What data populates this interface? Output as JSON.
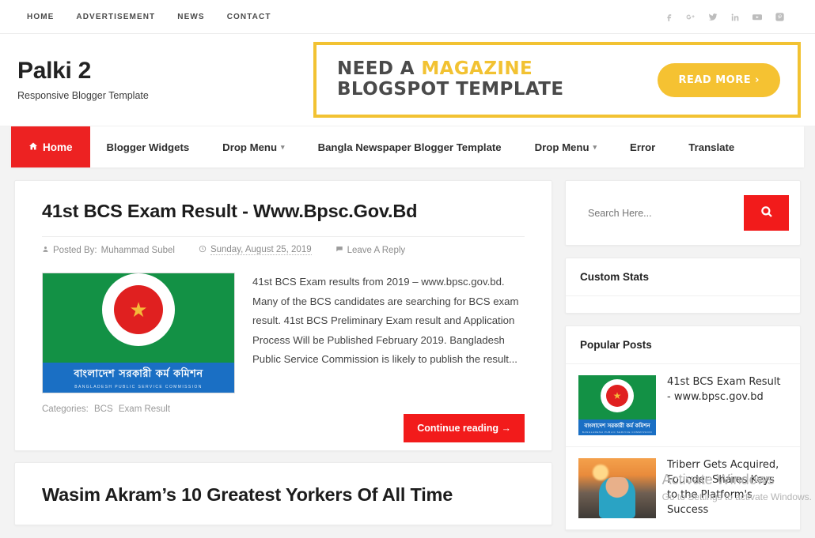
{
  "topbar": {
    "nav": [
      {
        "label": "HOME"
      },
      {
        "label": "ADVERTISEMENT"
      },
      {
        "label": "NEWS"
      },
      {
        "label": "CONTACT"
      }
    ],
    "social": [
      {
        "name": "facebook-icon",
        "glyph": "f"
      },
      {
        "name": "google-plus-icon",
        "glyph": "G+"
      },
      {
        "name": "twitter-icon",
        "glyph": "t"
      },
      {
        "name": "linkedin-icon",
        "glyph": "in"
      },
      {
        "name": "youtube-icon",
        "glyph": "yt"
      },
      {
        "name": "pinterest-icon",
        "glyph": "P"
      }
    ]
  },
  "header": {
    "site_title": "Palki 2",
    "tagline": "Responsive Blogger Template",
    "banner": {
      "line1_plain": "NEED A ",
      "line1_highlight": "MAGAZINE",
      "line2": "BLOGSPOT TEMPLATE",
      "button_label": "READ MORE ›",
      "border_color": "#f2c232",
      "accent_color": "#f2c232"
    }
  },
  "mainnav": {
    "home_label": "Home",
    "home_icon": "home-icon",
    "active_color": "#ed2222",
    "items": [
      {
        "label": "Blogger Widgets",
        "has_caret": false
      },
      {
        "label": "Drop Menu",
        "has_caret": true
      },
      {
        "label": "Bangla Newspaper Blogger Template",
        "has_caret": false
      },
      {
        "label": "Drop Menu",
        "has_caret": true
      },
      {
        "label": "Error",
        "has_caret": false
      },
      {
        "label": "Translate",
        "has_caret": false
      }
    ]
  },
  "posts": [
    {
      "title": "41st BCS Exam Result - Www.Bpsc.Gov.Bd",
      "meta": {
        "author_label": "Posted By:",
        "author": "Muhammad Subel",
        "date": "Sunday, August 25, 2019",
        "comments": "Leave A Reply"
      },
      "thumb": {
        "name": "bpsc-logo-thumbnail",
        "band_bn": "বাংলাদেশ সরকারী কর্ম কমিশন",
        "band_en": "BANGLADESH PUBLIC SERVICE COMMISSION"
      },
      "excerpt": "41st BCS Exam results from 2019 – www.bpsc.gov.bd. Many of the BCS candidates are searching for BCS exam result. 41st BCS Preliminary Exam result and Application Process Will be Published February 2019. Bangladesh Public Service Commission is likely to publish the result...",
      "categories_label": "Categories:",
      "categories": [
        "BCS",
        "Exam Result"
      ],
      "continue_label": "Continue reading →"
    },
    {
      "title": "Wasim Akram’s 10 Greatest Yorkers Of All Time"
    }
  ],
  "sidebar": {
    "search": {
      "placeholder": "Search Here...",
      "button_icon": "search-icon",
      "button_color": "#f21b1b"
    },
    "widgets": [
      {
        "title": "Custom Stats"
      },
      {
        "title": "Popular Posts"
      }
    ],
    "popular_posts": [
      {
        "title": "41st BCS Exam Result - www.bpsc.gov.bd",
        "thumb": "bpsc-logo-thumbnail",
        "band_bn": "বাংলাদেশ সরকারী কর্ম কমিশন",
        "band_en": "BANGLADESH PUBLIC SERVICE COMMISSION"
      },
      {
        "title": "Triberr Gets Acquired, Founder Shares Keys to the Platform's Success",
        "thumb": "child-sunset-photo"
      }
    ]
  },
  "watermark": {
    "line1": "Activate Windows",
    "line2": "Go to Settings to activate Windows."
  }
}
